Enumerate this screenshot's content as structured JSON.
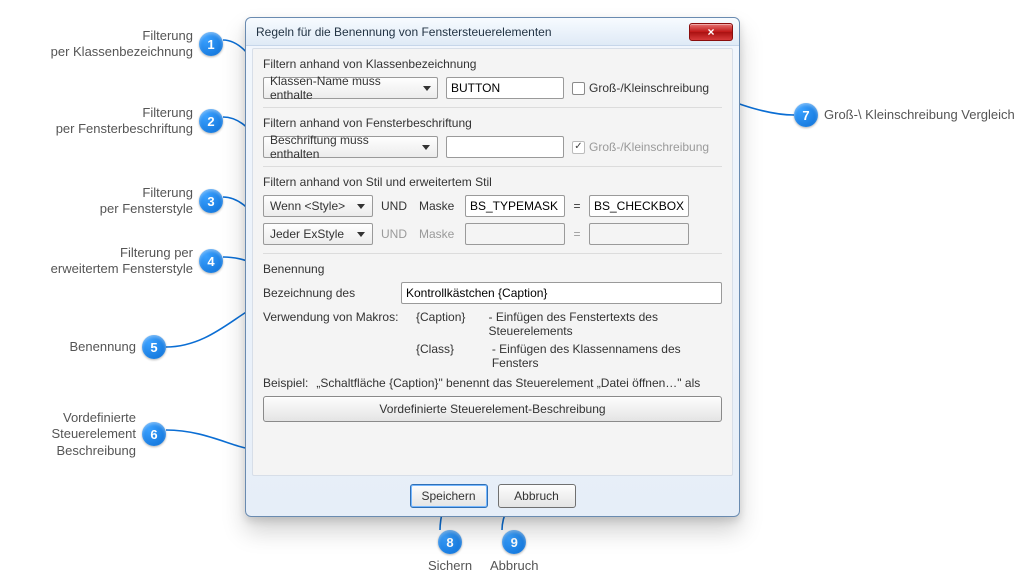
{
  "callouts": {
    "1": "Filterung\nper Klassenbezeichnung",
    "2": "Filterung\nper Fensterbeschriftung",
    "3": "Filterung\nper Fensterstyle",
    "4": "Filterung per\nerweitertem Fensterstyle",
    "5": "Benennung",
    "6": "Vordefinierte\nSteuerelement\nBeschreibung",
    "7": "Groß-\\ Kleinschreibung Vergleich",
    "8": "Sichern",
    "9": "Abbruch"
  },
  "dialog": {
    "title": "Regeln für die Benennung von Fenstersteuerelementen",
    "close": "×"
  },
  "sec_class": {
    "heading": "Filtern anhand von Klassenbezeichnung",
    "combo": "Klassen-Name muss enthalte",
    "value": "BUTTON",
    "case_label": "Groß-/Kleinschreibung"
  },
  "sec_caption": {
    "heading": "Filtern anhand von Fensterbeschriftung",
    "combo": "Beschriftung muss enthalten",
    "value": "",
    "case_label": "Groß-/Kleinschreibung"
  },
  "sec_style": {
    "heading": "Filtern anhand von Stil und erweitertem Stil",
    "style_combo": "Wenn  <Style>",
    "and": "UND",
    "mask": "Maske",
    "mask_val": "BS_TYPEMASK",
    "eq": "=",
    "res_val": "BS_CHECKBOX",
    "ex_combo": "Jeder ExStyle",
    "ex_mask_val": "",
    "ex_res_val": ""
  },
  "sec_name": {
    "heading": "Benennung",
    "label": "Bezeichnung des",
    "value": "Kontrollkästchen {Caption}",
    "macros_label": "Verwendung von Makros:",
    "macro_caption": "{Caption}",
    "macro_caption_desc": "- Einfügen des Fenstertexts des Steuerelements",
    "macro_class": "{Class}",
    "macro_class_desc": "- Einfügen des Klassennamens des Fensters",
    "example_label": "Beispiel:",
    "example_text": "„Schaltfläche {Caption}\" benennt das Steuerelement „Datei öffnen…\" als",
    "predef_btn": "Vordefinierte Steuerelement-Beschreibung"
  },
  "buttons": {
    "save": "Speichern",
    "cancel": "Abbruch"
  }
}
